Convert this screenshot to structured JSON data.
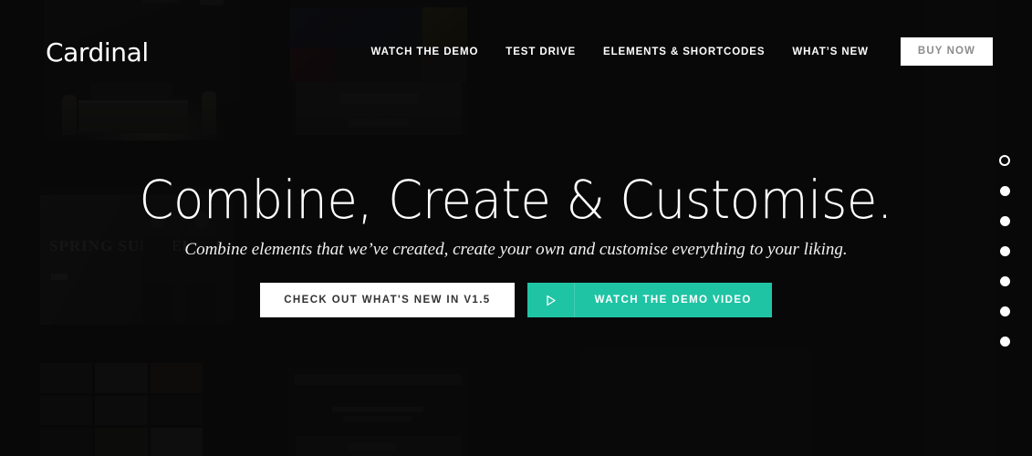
{
  "page": {
    "background_color": "#0d0d0d",
    "accent_color": "#1fc4a4",
    "text_color": "#ffffff"
  },
  "header": {
    "logo": "Cardinal",
    "nav_items": [
      {
        "label": "WATCH THE DEMO"
      },
      {
        "label": "TEST DRIVE"
      },
      {
        "label": "ELEMENTS & SHORTCODES"
      },
      {
        "label": "WHAT’S NEW"
      }
    ],
    "buy_button": "BUY NOW"
  },
  "hero": {
    "title": "Combine, Create & Customise.",
    "subtitle": "Combine elements that we’ve created, create your own and customise everything to your liking.",
    "primary_button": "CHECK OUT WHAT'S NEW IN V1.5",
    "secondary_button": "WATCH THE DEMO VIDEO",
    "secondary_button_icon": "play-icon"
  },
  "slide_nav": {
    "total": 7,
    "active_index": 1,
    "items": [
      {
        "index": 1,
        "active": true
      },
      {
        "index": 2,
        "active": false
      },
      {
        "index": 3,
        "active": false
      },
      {
        "index": 4,
        "active": false
      },
      {
        "index": 5,
        "active": false
      },
      {
        "index": 6,
        "active": false
      },
      {
        "index": 7,
        "active": false
      }
    ]
  },
  "background": {
    "fashion_tile_text": "SPRING\nSUMMER '14"
  }
}
